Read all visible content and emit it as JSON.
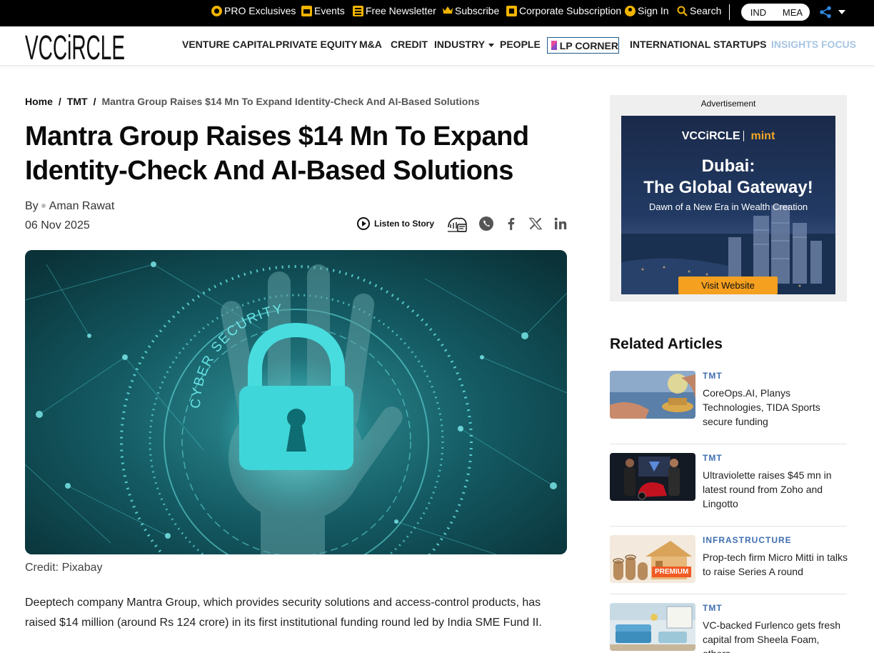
{
  "topbar": {
    "items": [
      "PRO Exclusives",
      "Events",
      "Free Newsletter",
      "Subscribe",
      "Corporate Subscription",
      "Sign In",
      "Search"
    ],
    "region": [
      "IND",
      "MEA"
    ]
  },
  "brand": {
    "logo": "VCCiRCLE"
  },
  "nav": {
    "items": [
      "VENTURE CAPITAL",
      "PRIVATE EQUITY",
      "M&A",
      "CREDIT",
      "INDUSTRY",
      "PEOPLE",
      "LP CORNER",
      "INTERNATIONAL",
      "STARTUPS",
      "INSIGHTS FOCUS"
    ]
  },
  "breadcrumb": {
    "home": "Home",
    "section": "TMT",
    "current": "Mantra Group Raises $14 Mn To Expand Identity-Check And AI-Based Solutions",
    "sep": "/"
  },
  "article": {
    "title": "Mantra Group Raises $14 Mn To Expand Identity-Check And AI-Based Solutions",
    "by": "By",
    "author": "Aman Rawat",
    "date": "06 Nov 2025",
    "listen": "Listen to Story",
    "hero_text": "CYBER SECURITY",
    "credit": "Credit: Pixabay",
    "paragraph": "Deeptech company Mantra Group, which provides security solutions and access-control products, has raised $14 million (around Rs 124 crore) in its first institutional funding round led by India SME Fund II."
  },
  "ad": {
    "label": "Advertisement",
    "brand": "VCCiRCLE",
    "partner": "mint",
    "headline1": "Dubai:",
    "headline2": "The Global Gateway!",
    "sub": "Dawn of a New Era in Wealth Creation",
    "cta": "Visit Website"
  },
  "related": {
    "heading": "Related Articles",
    "items": [
      {
        "category": "TMT",
        "title": "CoreOps.AI, Planys Technologies, TIDA Sports secure funding"
      },
      {
        "category": "TMT",
        "title": "Ultraviolette raises $45 mn in latest round from Zoho and Lingotto"
      },
      {
        "category": "INFRASTRUCTURE",
        "title": "Prop-tech firm Micro Mitti in talks to raise Series A round",
        "badge": "PREMIUM"
      },
      {
        "category": "TMT",
        "title": "VC-backed Furlenco gets fresh capital from Sheela Foam, others"
      }
    ]
  },
  "colors": {
    "accent_blue": "#3f6fb0",
    "topbar_bg": "#000000",
    "icon_gold": "#f0b400",
    "cta_orange": "#f5a01f",
    "hero_teal": "#2fd3d6"
  }
}
